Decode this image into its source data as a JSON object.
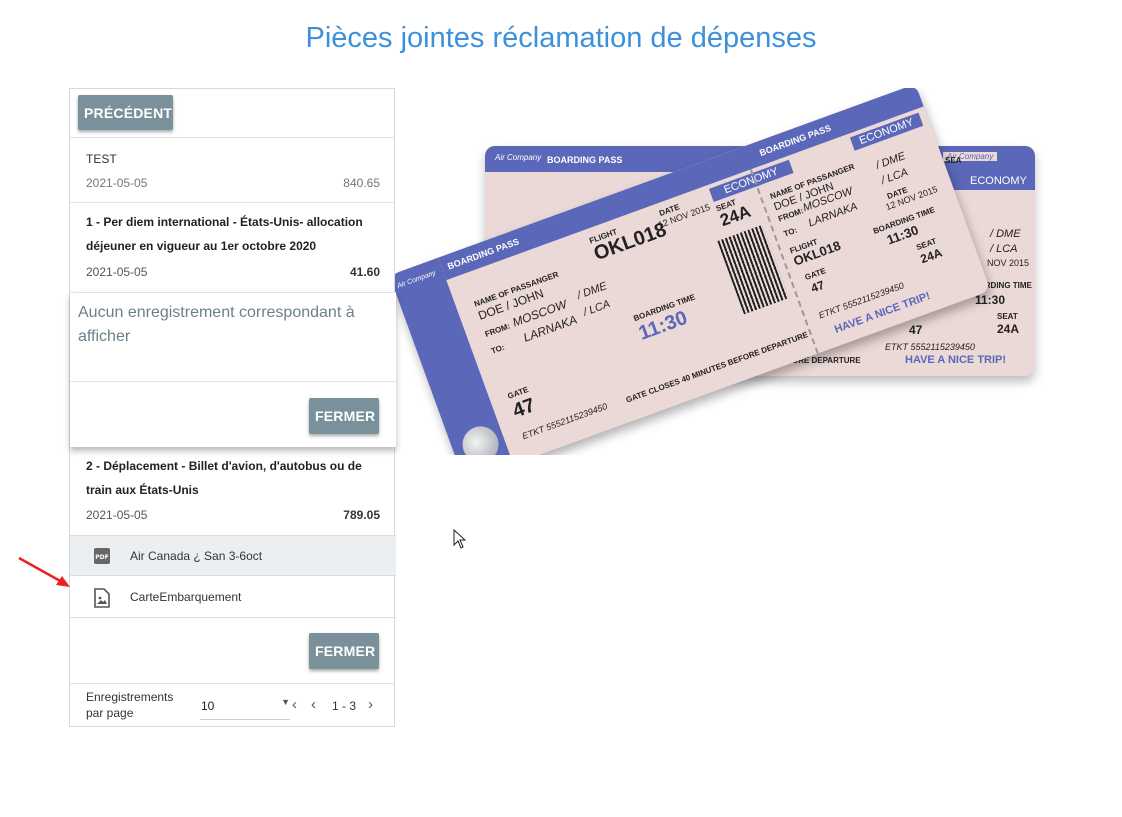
{
  "page": {
    "title": "Pièces jointes réclamation de dépenses"
  },
  "panel": {
    "prev_button": "PRÉCÉDENT",
    "items": [
      {
        "title": "TEST",
        "date": "2021-05-05",
        "amount": "840.65"
      },
      {
        "title": "1 - Per diem international - États-Unis- allocation déjeuner en vigueur au 1er octobre 2020",
        "date": "2021-05-05",
        "amount": "41.60"
      },
      {
        "title": "2 - Déplacement - Billet d'avion, d'autobus ou de train aux États-Unis",
        "date": "2021-05-05",
        "amount": "789.05"
      }
    ],
    "popup": {
      "message": "Aucun enregistrement correspondant à afficher",
      "close_button": "FERMER"
    },
    "attachments": [
      {
        "name": "Air Canada ¿ San 3-6oct",
        "icon": "pdf-icon"
      },
      {
        "name": "CarteEmbarquement",
        "icon": "image-file-icon"
      }
    ],
    "close_button": "FERMER",
    "pagination": {
      "label": "Enregistrements par page",
      "per_page": "10",
      "range": "1 - 3"
    }
  },
  "ticket_front": {
    "company": "Air Company",
    "boarding_pass": "BOARDING PASS",
    "class": "ECONOMY",
    "name_label": "NAME OF PASSANGER",
    "name": "DOE / JOHN",
    "from_label": "FROM:",
    "from": "MOSCOW",
    "from_code": "/ DME",
    "to_label": "TO:",
    "to": "LARNAKA",
    "to_code": "/ LCA",
    "flight_label": "FLIGHT",
    "flight": "OKL018",
    "date_label": "DATE",
    "date": "12 NOV 2015",
    "seat_label": "SEAT",
    "seat": "24A",
    "boarding_time_label": "BOARDING TIME",
    "boarding_time": "11:30",
    "gate_label": "GATE",
    "gate": "47",
    "etkt": "ETKT 5552115239450",
    "gate_closes": "GATE CLOSES 40 MINUTES BEFORE DEPARTURE",
    "nice_trip": "HAVE A NICE TRIP!"
  },
  "ticket_back": {
    "company": "Air Company",
    "boarding_pass": "BOARDING PASS",
    "class": "ECONOMY",
    "boarding_time_label": "BOARDING TIME",
    "boarding_time": "11:30",
    "seat_label": "SEAT",
    "seat": "24A",
    "gate": "47",
    "from_code": "/ DME",
    "to_code": "/ LCA",
    "date": "NOV 2015",
    "etkt": "ETKT 5552115239450",
    "before_departure": "ES BEFORE DEPARTURE",
    "nice_trip": "HAVE A NICE TRIP!",
    "seat_short": "SEA"
  },
  "colors": {
    "accent": "#3d91dc",
    "button": "#7a909a",
    "ticket_blue": "#5b67b8",
    "ticket_pink": "#ebd9d7",
    "arrow": "#e8221f"
  }
}
